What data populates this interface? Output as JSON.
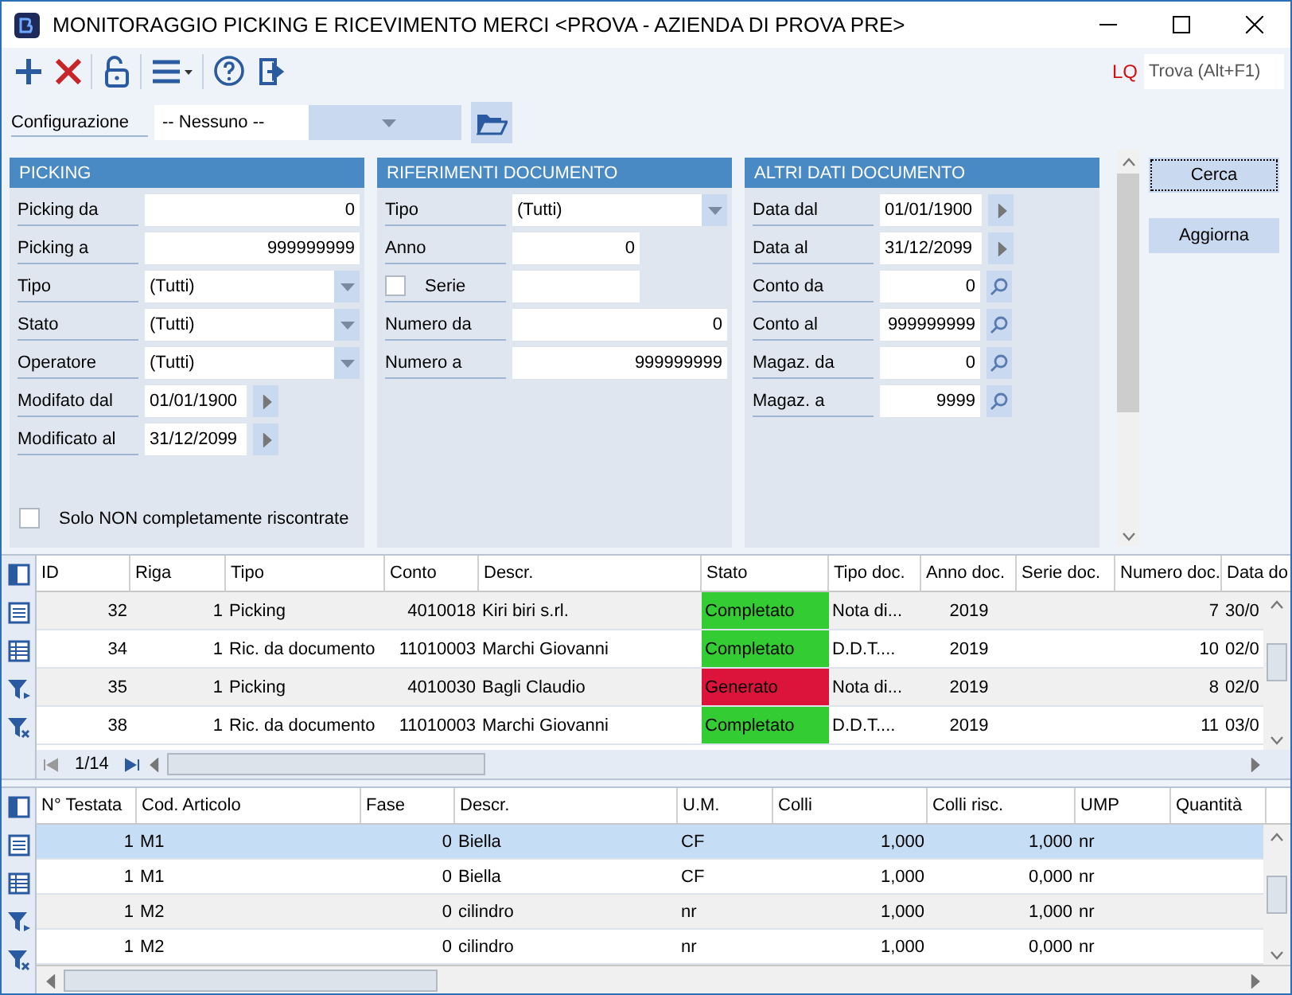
{
  "window": {
    "title": "MONITORAGGIO PICKING E RICEVIMENTO MERCI <PROVA - AZIENDA DI PROVA PRE>"
  },
  "toolbar": {
    "search_prefix": "LQ",
    "search": {
      "placeholder": "Trova (Alt+F1)"
    }
  },
  "configuration": {
    "label": "Configurazione",
    "value": "-- Nessuno --"
  },
  "panels": [
    {
      "title": "PICKING",
      "fields": [
        {
          "label": "Picking da",
          "kind": "number",
          "value": "0"
        },
        {
          "label": "Picking a",
          "kind": "number",
          "value": "999999999"
        },
        {
          "label": "Tipo",
          "kind": "combo",
          "value": "(Tutti)"
        },
        {
          "label": "Stato",
          "kind": "combo",
          "value": "(Tutti)"
        },
        {
          "label": "Operatore",
          "kind": "combo",
          "value": "(Tutti)"
        },
        {
          "label": "Modifato dal",
          "kind": "date",
          "value": "01/01/1900"
        },
        {
          "label": "Modificato al",
          "kind": "date",
          "value": "31/12/2099"
        }
      ],
      "checkbox": {
        "label": "Solo NON completamente riscontrate",
        "checked": false
      }
    },
    {
      "title": "RIFERIMENTI DOCUMENTO",
      "fields": [
        {
          "label": "Tipo",
          "kind": "combo",
          "value": "(Tutti)"
        },
        {
          "label": "Anno",
          "kind": "number-short",
          "value": "0"
        },
        {
          "label": "Serie",
          "kind": "check",
          "checked": false
        },
        {
          "label": "Numero da",
          "kind": "number",
          "value": "0"
        },
        {
          "label": "Numero a",
          "kind": "number",
          "value": "999999999"
        }
      ]
    },
    {
      "title": "ALTRI DATI DOCUMENTO",
      "fields": [
        {
          "label": "Data dal",
          "kind": "date",
          "value": "01/01/1900"
        },
        {
          "label": "Data al",
          "kind": "date",
          "value": "31/12/2099"
        },
        {
          "label": "Conto da",
          "kind": "lookup",
          "value": "0"
        },
        {
          "label": "Conto al",
          "kind": "lookup",
          "value": "999999999"
        },
        {
          "label": "Magaz. da",
          "kind": "lookup",
          "value": "0"
        },
        {
          "label": "Magaz. a",
          "kind": "lookup",
          "value": "9999"
        }
      ]
    }
  ],
  "buttons": [
    {
      "label": "Cerca",
      "focused": true
    },
    {
      "label": "Aggiorna",
      "focused": false
    }
  ],
  "picking_table": {
    "columns": [
      "ID",
      "Riga",
      "Tipo",
      "Conto",
      "Descr.",
      "Stato",
      "Tipo doc.",
      "Anno doc.",
      "Serie doc.",
      "Numero doc.",
      "Data do"
    ],
    "rows": [
      {
        "selected": false,
        "cells": [
          "32",
          "1",
          "Picking",
          "4010018",
          "Kiri biri s.rl.",
          {
            "text": "Completato",
            "color": "#33cc33"
          },
          "Nota di...",
          "2019",
          "",
          "7",
          "30/0"
        ]
      },
      {
        "selected": false,
        "cells": [
          "34",
          "1",
          "Ric. da documento",
          "11010003",
          "Marchi Giovanni",
          {
            "text": "Completato",
            "color": "#33cc33"
          },
          "D.D.T....",
          "2019",
          "",
          "10",
          "02/0"
        ]
      },
      {
        "selected": false,
        "cells": [
          "35",
          "1",
          "Picking",
          "4010030",
          "Bagli Claudio",
          {
            "text": "Generato",
            "color": "#dc143c"
          },
          "Nota di...",
          "2019",
          "",
          "8",
          "02/0"
        ]
      },
      {
        "selected": false,
        "cells": [
          "38",
          "1",
          "Ric. da documento",
          "11010003",
          "Marchi Giovanni",
          {
            "text": "Completato",
            "color": "#33cc33"
          },
          "D.D.T....",
          "2019",
          "",
          "11",
          "03/0"
        ]
      }
    ],
    "pager": "1/14"
  },
  "detail_table": {
    "columns": [
      "N° Testata",
      "Cod. Articolo",
      "Fase",
      "Descr.",
      "U.M.",
      "Colli",
      "Colli risc.",
      "UMP",
      "Quantità"
    ],
    "rows": [
      {
        "selected": true,
        "cells": [
          "1",
          "M1",
          "0",
          "Biella",
          "CF",
          "1,000",
          "1,000",
          "nr"
        ]
      },
      {
        "selected": false,
        "cells": [
          "1",
          "M1",
          "0",
          "Biella",
          "CF",
          "1,000",
          "0,000",
          "nr"
        ]
      },
      {
        "selected": false,
        "cells": [
          "1",
          "M2",
          "0",
          "cilindro",
          "nr",
          "1,000",
          "1,000",
          "nr"
        ]
      },
      {
        "selected": false,
        "cells": [
          "1",
          "M2",
          "0",
          "cilindro",
          "nr",
          "1,000",
          "0,000",
          "nr"
        ]
      }
    ]
  }
}
